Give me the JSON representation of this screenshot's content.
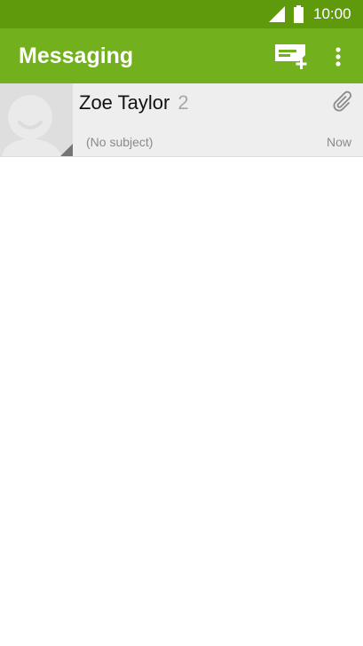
{
  "status_bar": {
    "time": "10:00",
    "signal_icon": "signal-icon",
    "battery_icon": "battery-icon"
  },
  "app_bar": {
    "title": "Messaging",
    "compose_icon": "new-message-icon",
    "overflow_icon": "more-vert-icon",
    "color": "#72b01d",
    "status_color": "#5f9a0c"
  },
  "conversations": [
    {
      "contact": "Zoe Taylor",
      "count": "2",
      "subject": "(No subject)",
      "time": "Now",
      "has_attachment": true,
      "attachment_icon": "paperclip-icon",
      "avatar_icon": "default-avatar-icon"
    }
  ]
}
